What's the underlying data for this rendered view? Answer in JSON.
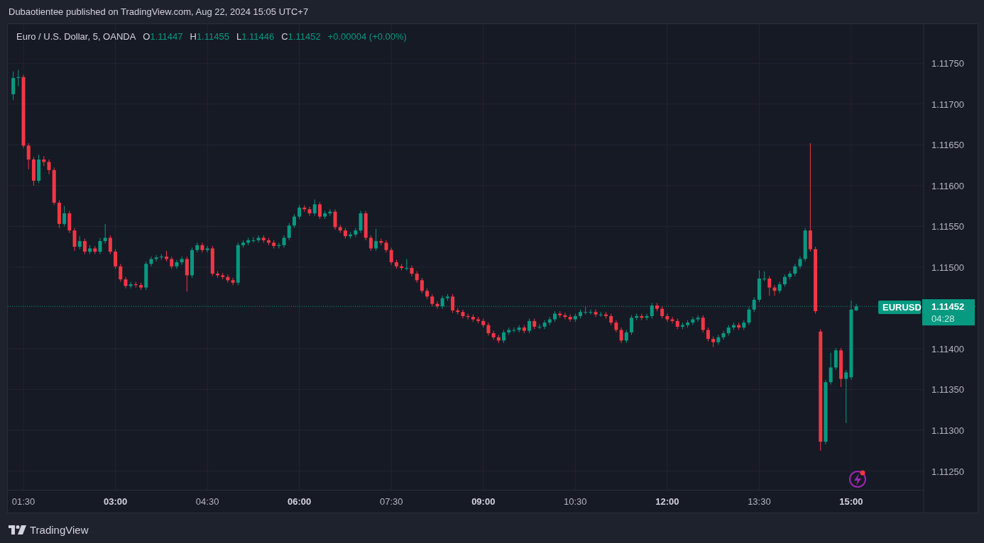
{
  "header": {
    "publisher_line": "Dubaotientee published on TradingView.com, Aug 22, 2024 15:05 UTC+7"
  },
  "chart": {
    "legend": {
      "symbol": "Euro / U.S. Dollar, 5, OANDA",
      "ohlc": [
        {
          "label": "O",
          "value": "1.11447"
        },
        {
          "label": "H",
          "value": "1.11455"
        },
        {
          "label": "L",
          "value": "1.11446"
        },
        {
          "label": "C",
          "value": "1.11452"
        }
      ],
      "change": "+0.00004 (+0.00%)"
    },
    "symbol_badge": "EURUSD",
    "price_badge": {
      "countdown": "04:28"
    },
    "chart_data": {
      "type": "candlestick",
      "grid": true,
      "x": [
        80,
        85,
        90,
        95,
        100,
        105,
        110,
        115,
        120,
        125,
        130,
        135,
        140,
        145,
        150,
        155,
        160,
        165,
        170,
        175,
        180,
        185,
        190,
        195,
        200,
        205,
        210,
        215,
        220,
        225,
        230,
        235,
        240,
        245,
        250,
        255,
        260,
        265,
        270,
        275,
        280,
        285,
        290,
        295,
        300,
        305,
        310,
        315,
        320,
        325,
        330,
        335,
        340,
        345,
        350,
        355,
        360,
        365,
        370,
        375,
        380,
        385,
        390,
        395,
        400,
        405,
        410,
        415,
        420,
        425,
        430,
        435,
        440,
        445,
        450,
        455,
        460,
        465,
        470,
        475,
        480,
        485,
        490,
        495,
        500,
        505,
        510,
        515,
        520,
        525,
        530,
        535,
        540,
        545,
        550,
        555,
        560,
        565,
        570,
        575,
        580,
        585,
        590,
        595,
        600,
        605,
        610,
        615,
        620,
        625,
        630,
        635,
        640,
        645,
        650,
        655,
        660,
        665,
        670,
        675,
        680,
        685,
        690,
        695,
        700,
        705,
        710,
        715,
        720,
        725,
        730,
        735,
        740,
        745,
        750,
        755,
        760,
        765,
        770,
        775,
        780,
        785,
        790,
        795,
        800,
        805,
        810,
        815,
        820,
        825,
        830,
        835,
        840,
        845,
        850,
        855,
        860,
        865,
        870,
        875,
        880,
        885,
        890,
        895,
        900,
        905
      ],
      "ohlc": [
        [
          1.11712,
          1.1174,
          1.11705,
          1.11732
        ],
        [
          1.11732,
          1.11742,
          1.11722,
          1.11733
        ],
        [
          1.11733,
          1.11736,
          1.11646,
          1.11649
        ],
        [
          1.11649,
          1.11652,
          1.1162,
          1.11632
        ],
        [
          1.11632,
          1.11635,
          1.116,
          1.11606
        ],
        [
          1.11606,
          1.11638,
          1.11603,
          1.11632
        ],
        [
          1.11632,
          1.11636,
          1.11624,
          1.11629
        ],
        [
          1.11629,
          1.11632,
          1.11614,
          1.11619
        ],
        [
          1.11619,
          1.11622,
          1.11576,
          1.11579
        ],
        [
          1.11579,
          1.11582,
          1.11548,
          1.11553
        ],
        [
          1.11553,
          1.11575,
          1.1155,
          1.11566
        ],
        [
          1.11566,
          1.11569,
          1.11542,
          1.11545
        ],
        [
          1.11545,
          1.11548,
          1.1152,
          1.11525
        ],
        [
          1.11525,
          1.11538,
          1.11522,
          1.11532
        ],
        [
          1.11532,
          1.11535,
          1.11516,
          1.11519
        ],
        [
          1.11519,
          1.11527,
          1.11516,
          1.11523
        ],
        [
          1.11523,
          1.11526,
          1.11516,
          1.11519
        ],
        [
          1.11519,
          1.11536,
          1.11516,
          1.11532
        ],
        [
          1.11532,
          1.11553,
          1.11529,
          1.11536
        ],
        [
          1.11536,
          1.11539,
          1.11516,
          1.11519
        ],
        [
          1.11519,
          1.11522,
          1.11498,
          1.11501
        ],
        [
          1.11501,
          1.11504,
          1.11482,
          1.11485
        ],
        [
          1.11485,
          1.11488,
          1.11474,
          1.11477
        ],
        [
          1.11477,
          1.11482,
          1.11474,
          1.11479
        ],
        [
          1.11479,
          1.11482,
          1.11475,
          1.11478
        ],
        [
          1.11478,
          1.11481,
          1.11472,
          1.11475
        ],
        [
          1.11475,
          1.11507,
          1.11472,
          1.11504
        ],
        [
          1.11504,
          1.11513,
          1.11501,
          1.1151
        ],
        [
          1.1151,
          1.11515,
          1.11507,
          1.11512
        ],
        [
          1.11512,
          1.11516,
          1.11509,
          1.11513
        ],
        [
          1.11513,
          1.1152,
          1.11507,
          1.1151
        ],
        [
          1.1151,
          1.11513,
          1.11498,
          1.11501
        ],
        [
          1.11501,
          1.11509,
          1.11498,
          1.11506
        ],
        [
          1.11506,
          1.11513,
          1.11503,
          1.1151
        ],
        [
          1.1151,
          1.11513,
          1.1147,
          1.1149
        ],
        [
          1.1149,
          1.11524,
          1.11487,
          1.11521
        ],
        [
          1.11521,
          1.1153,
          1.11518,
          1.11527
        ],
        [
          1.11527,
          1.1153,
          1.11518,
          1.11521
        ],
        [
          1.11521,
          1.11526,
          1.11518,
          1.11523
        ],
        [
          1.11523,
          1.11526,
          1.11489,
          1.11492
        ],
        [
          1.11492,
          1.11495,
          1.11487,
          1.1149
        ],
        [
          1.1149,
          1.11493,
          1.11485,
          1.11488
        ],
        [
          1.11488,
          1.11491,
          1.11481,
          1.11484
        ],
        [
          1.11484,
          1.11487,
          1.11478,
          1.11481
        ],
        [
          1.11481,
          1.1153,
          1.11478,
          1.11527
        ],
        [
          1.11527,
          1.11533,
          1.11524,
          1.1153
        ],
        [
          1.1153,
          1.11536,
          1.11527,
          1.11533
        ],
        [
          1.11533,
          1.11537,
          1.1153,
          1.11533
        ],
        [
          1.11533,
          1.11539,
          1.1153,
          1.11536
        ],
        [
          1.11536,
          1.11539,
          1.1153,
          1.11533
        ],
        [
          1.11533,
          1.11536,
          1.11527,
          1.1153
        ],
        [
          1.1153,
          1.11533,
          1.11523,
          1.11526
        ],
        [
          1.11526,
          1.1153,
          1.11523,
          1.11527
        ],
        [
          1.11527,
          1.11539,
          1.11524,
          1.11536
        ],
        [
          1.11536,
          1.11554,
          1.11533,
          1.11551
        ],
        [
          1.11551,
          1.11565,
          1.11548,
          1.11562
        ],
        [
          1.11562,
          1.11576,
          1.11559,
          1.11573
        ],
        [
          1.11573,
          1.11576,
          1.11568,
          1.11571
        ],
        [
          1.11571,
          1.11574,
          1.11563,
          1.11566
        ],
        [
          1.11566,
          1.11583,
          1.11563,
          1.11577
        ],
        [
          1.11577,
          1.1158,
          1.11559,
          1.11562
        ],
        [
          1.11562,
          1.11569,
          1.11559,
          1.11566
        ],
        [
          1.11566,
          1.11571,
          1.11563,
          1.11568
        ],
        [
          1.11568,
          1.11571,
          1.11546,
          1.11549
        ],
        [
          1.11549,
          1.11552,
          1.11542,
          1.11545
        ],
        [
          1.11545,
          1.11548,
          1.11535,
          1.11538
        ],
        [
          1.11538,
          1.11543,
          1.11535,
          1.1154
        ],
        [
          1.1154,
          1.11548,
          1.11537,
          1.11545
        ],
        [
          1.11545,
          1.11569,
          1.11542,
          1.11566
        ],
        [
          1.11566,
          1.11569,
          1.11533,
          1.11536
        ],
        [
          1.11536,
          1.11539,
          1.1152,
          1.11523
        ],
        [
          1.11523,
          1.11547,
          1.1152,
          1.11532
        ],
        [
          1.11532,
          1.11535,
          1.11527,
          1.1153
        ],
        [
          1.1153,
          1.11533,
          1.11518,
          1.11521
        ],
        [
          1.11521,
          1.11524,
          1.11503,
          1.11506
        ],
        [
          1.11506,
          1.11509,
          1.11498,
          1.11501
        ],
        [
          1.11501,
          1.11504,
          1.11496,
          1.11499
        ],
        [
          1.11499,
          1.1151,
          1.11496,
          1.11499
        ],
        [
          1.11499,
          1.11502,
          1.11489,
          1.11492
        ],
        [
          1.11492,
          1.11495,
          1.11481,
          1.11484
        ],
        [
          1.11484,
          1.11487,
          1.11468,
          1.11471
        ],
        [
          1.11471,
          1.11474,
          1.11461,
          1.11464
        ],
        [
          1.11464,
          1.11467,
          1.11452,
          1.11455
        ],
        [
          1.11455,
          1.11458,
          1.11449,
          1.11452
        ],
        [
          1.11452,
          1.11465,
          1.11449,
          1.11462
        ],
        [
          1.11462,
          1.11467,
          1.11459,
          1.11464
        ],
        [
          1.11464,
          1.11467,
          1.11444,
          1.11447
        ],
        [
          1.11447,
          1.1145,
          1.11442,
          1.11445
        ],
        [
          1.11445,
          1.11448,
          1.11437,
          1.1144
        ],
        [
          1.1144,
          1.11443,
          1.11436,
          1.11439
        ],
        [
          1.11439,
          1.11442,
          1.11433,
          1.11436
        ],
        [
          1.11436,
          1.11439,
          1.11431,
          1.11434
        ],
        [
          1.11434,
          1.11437,
          1.11426,
          1.11429
        ],
        [
          1.11429,
          1.11432,
          1.11416,
          1.11419
        ],
        [
          1.11419,
          1.11422,
          1.11411,
          1.11414
        ],
        [
          1.11414,
          1.11417,
          1.11407,
          1.1141
        ],
        [
          1.1141,
          1.11423,
          1.11407,
          1.1142
        ],
        [
          1.1142,
          1.11426,
          1.11417,
          1.11423
        ],
        [
          1.11423,
          1.11426,
          1.1142,
          1.11423
        ],
        [
          1.11423,
          1.11429,
          1.1142,
          1.11426
        ],
        [
          1.11426,
          1.11429,
          1.11419,
          1.11422
        ],
        [
          1.11422,
          1.11437,
          1.11419,
          1.11434
        ],
        [
          1.11434,
          1.11437,
          1.11424,
          1.11427
        ],
        [
          1.11427,
          1.1143,
          1.11424,
          1.11427
        ],
        [
          1.11427,
          1.11435,
          1.11424,
          1.11432
        ],
        [
          1.11432,
          1.11439,
          1.11429,
          1.11436
        ],
        [
          1.11436,
          1.11446,
          1.11433,
          1.11443
        ],
        [
          1.11443,
          1.11446,
          1.11438,
          1.11441
        ],
        [
          1.11441,
          1.11444,
          1.11436,
          1.11439
        ],
        [
          1.11439,
          1.11442,
          1.11433,
          1.11436
        ],
        [
          1.11436,
          1.11443,
          1.11433,
          1.1144
        ],
        [
          1.1144,
          1.11448,
          1.11437,
          1.11445
        ],
        [
          1.11445,
          1.11452,
          1.11442,
          1.11445
        ],
        [
          1.11445,
          1.11448,
          1.11442,
          1.11445
        ],
        [
          1.11445,
          1.11448,
          1.11439,
          1.11442
        ],
        [
          1.11442,
          1.11445,
          1.11439,
          1.11442
        ],
        [
          1.11442,
          1.11445,
          1.11437,
          1.1144
        ],
        [
          1.1144,
          1.11443,
          1.11429,
          1.11432
        ],
        [
          1.11432,
          1.11435,
          1.1142,
          1.11423
        ],
        [
          1.11423,
          1.11426,
          1.11407,
          1.1141
        ],
        [
          1.1141,
          1.11423,
          1.11407,
          1.1142
        ],
        [
          1.1142,
          1.11441,
          1.11417,
          1.11438
        ],
        [
          1.11438,
          1.11443,
          1.11435,
          1.1144
        ],
        [
          1.1144,
          1.11443,
          1.11435,
          1.11438
        ],
        [
          1.11438,
          1.11443,
          1.11435,
          1.1144
        ],
        [
          1.1144,
          1.11456,
          1.11437,
          1.11453
        ],
        [
          1.11453,
          1.11456,
          1.11446,
          1.11449
        ],
        [
          1.11449,
          1.11452,
          1.11437,
          1.1144
        ],
        [
          1.1144,
          1.11443,
          1.11433,
          1.11436
        ],
        [
          1.11436,
          1.11439,
          1.11431,
          1.11434
        ],
        [
          1.11434,
          1.11437,
          1.11424,
          1.11427
        ],
        [
          1.11427,
          1.11432,
          1.11424,
          1.11429
        ],
        [
          1.11429,
          1.11435,
          1.11426,
          1.11432
        ],
        [
          1.11432,
          1.11439,
          1.11429,
          1.11436
        ],
        [
          1.11436,
          1.11441,
          1.11433,
          1.11438
        ],
        [
          1.11438,
          1.11441,
          1.1142,
          1.11423
        ],
        [
          1.11423,
          1.11426,
          1.11409,
          1.11412
        ],
        [
          1.11412,
          1.11415,
          1.11402,
          1.11408
        ],
        [
          1.11408,
          1.11417,
          1.11405,
          1.11414
        ],
        [
          1.11414,
          1.11422,
          1.11411,
          1.11419
        ],
        [
          1.11419,
          1.11429,
          1.11416,
          1.11426
        ],
        [
          1.11426,
          1.11432,
          1.11423,
          1.11429
        ],
        [
          1.11429,
          1.11432,
          1.11423,
          1.11426
        ],
        [
          1.11426,
          1.11435,
          1.11423,
          1.11432
        ],
        [
          1.11432,
          1.11451,
          1.11429,
          1.11448
        ],
        [
          1.11448,
          1.11463,
          1.11445,
          1.1146
        ],
        [
          1.1146,
          1.11496,
          1.11457,
          1.11486
        ],
        [
          1.11486,
          1.11495,
          1.11483,
          1.11486
        ],
        [
          1.11486,
          1.11489,
          1.11465,
          1.11475
        ],
        [
          1.11475,
          1.11478,
          1.11465,
          1.11471
        ],
        [
          1.11471,
          1.11482,
          1.11468,
          1.11479
        ],
        [
          1.11479,
          1.11491,
          1.11476,
          1.11488
        ],
        [
          1.11488,
          1.11495,
          1.11485,
          1.11492
        ],
        [
          1.11492,
          1.11504,
          1.11489,
          1.11501
        ],
        [
          1.11501,
          1.11513,
          1.11498,
          1.1151
        ],
        [
          1.1151,
          1.11548,
          1.11507,
          1.11545
        ],
        [
          1.11545,
          1.11652,
          1.11519,
          1.11522
        ],
        [
          1.11522,
          1.11525,
          1.11443,
          1.11446
        ],
        [
          1.11421,
          1.11424,
          1.11275,
          1.11286
        ],
        [
          1.11286,
          1.11362,
          1.11283,
          1.11359
        ],
        [
          1.11359,
          1.11395,
          1.11356,
          1.11377
        ],
        [
          1.11377,
          1.11401,
          1.11374,
          1.11398
        ],
        [
          1.11398,
          1.11401,
          1.11353,
          1.11363
        ],
        [
          1.11363,
          1.11374,
          1.11309,
          1.11371
        ],
        [
          1.11365,
          1.11459,
          1.11362,
          1.11448
        ],
        [
          1.11447,
          1.11455,
          1.11446,
          1.11452
        ]
      ],
      "ref_lines": [
        {
          "axis": "y",
          "value": 1.11452,
          "label": "1.11452",
          "color": "#089981"
        }
      ],
      "xlim": [
        74.7,
        970.9
      ],
      "ylim": [
        1.11227,
        1.11798
      ],
      "yticks": [
        {
          "value": 1.1175,
          "label": "1.11750"
        },
        {
          "value": 1.117,
          "label": "1.11700"
        },
        {
          "value": 1.1165,
          "label": "1.11650"
        },
        {
          "value": 1.116,
          "label": "1.11600"
        },
        {
          "value": 1.1155,
          "label": "1.11550"
        },
        {
          "value": 1.115,
          "label": "1.11500"
        },
        {
          "value": 1.114,
          "label": "1.11400"
        },
        {
          "value": 1.1135,
          "label": "1.11350"
        },
        {
          "value": 1.113,
          "label": "1.11300"
        },
        {
          "value": 1.1125,
          "label": "1.11250"
        }
      ],
      "xticks": [
        {
          "value": 90,
          "label": "01:30"
        },
        {
          "value": 180,
          "label": "03:00"
        },
        {
          "value": 270,
          "label": "04:30"
        },
        {
          "value": 360,
          "label": "06:00"
        },
        {
          "value": 450,
          "label": "07:30"
        },
        {
          "value": 540,
          "label": "09:00"
        },
        {
          "value": 630,
          "label": "10:30"
        },
        {
          "value": 720,
          "label": "12:00"
        },
        {
          "value": 810,
          "label": "13:30"
        },
        {
          "value": 900,
          "label": "15:00"
        }
      ]
    }
  },
  "footer": {
    "brand": "TradingView"
  }
}
